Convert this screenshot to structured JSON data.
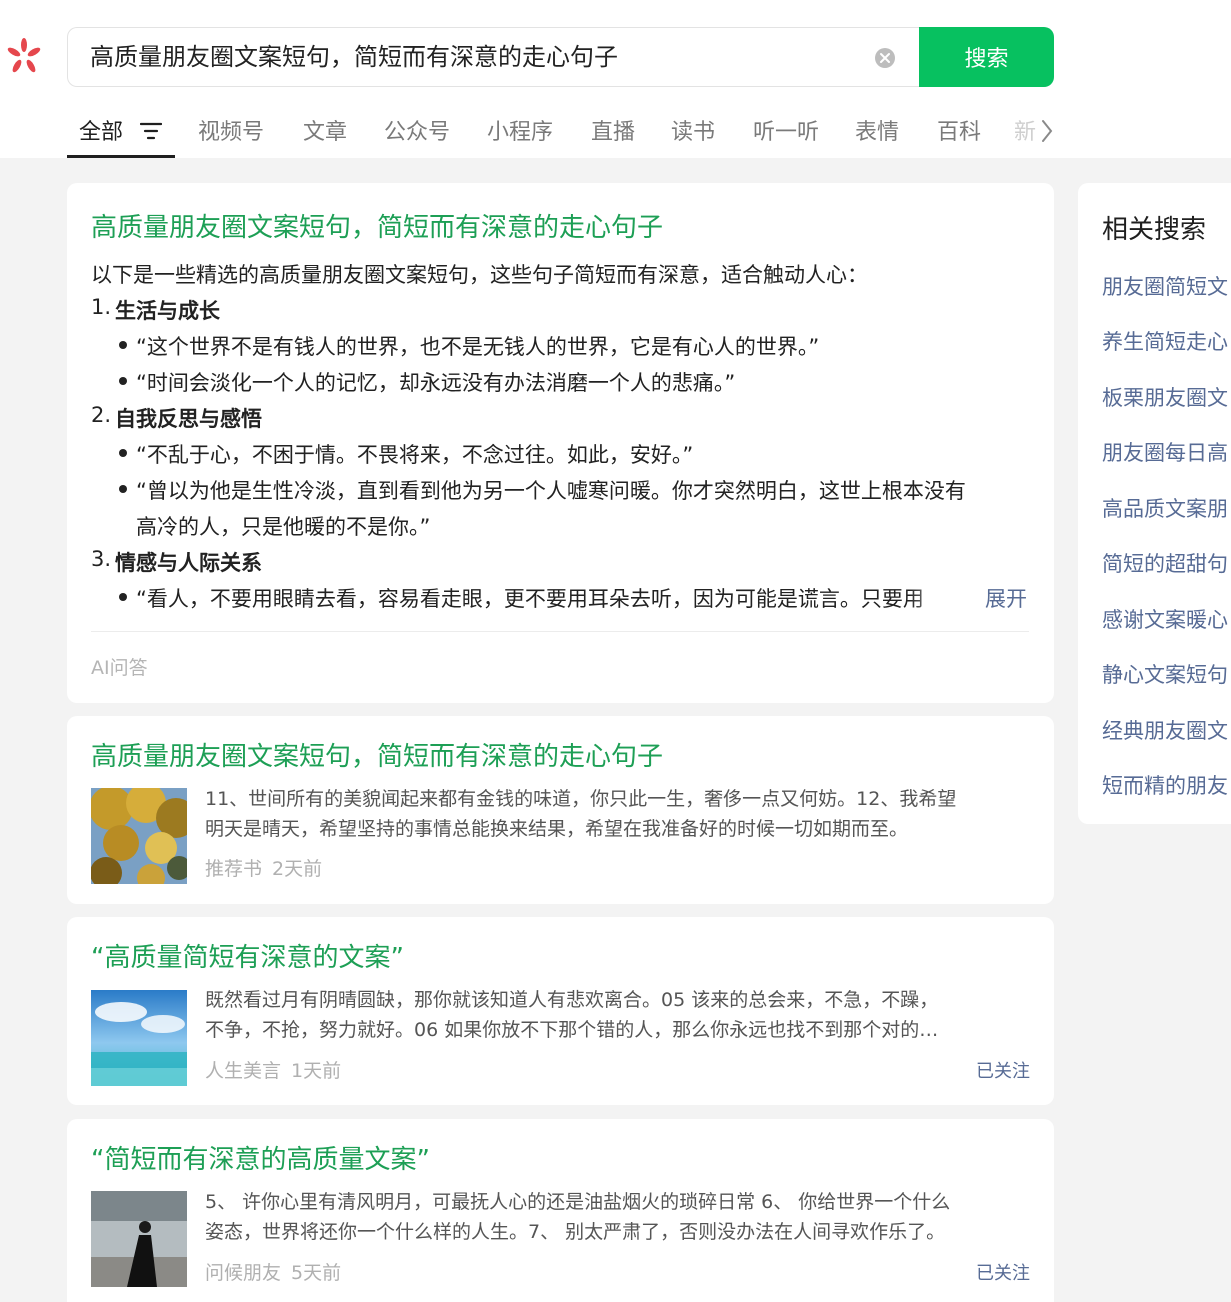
{
  "search": {
    "query": "高质量朋友圈文案短句，简短而有深意的走心句子",
    "button_label": "搜索"
  },
  "tabs": {
    "items": [
      "全部",
      "视频号",
      "文章",
      "公众号",
      "小程序",
      "直播",
      "读书",
      "听一听",
      "表情",
      "百科"
    ],
    "overflow_partial": "新"
  },
  "ai_card": {
    "title": "高质量朋友圈文案短句，简短而有深意的走心句子",
    "intro": "以下是一些精选的高质量朋友圈文案短句，这些句子简短而有深意，适合触动人心：",
    "sections": [
      {
        "num": "1.",
        "head": "生活与成长"
      },
      {
        "num": "2.",
        "head": "自我反思与感悟"
      },
      {
        "num": "3.",
        "head": "情感与人际关系"
      }
    ],
    "bullets": [
      "“这个世界不是有钱人的世界，也不是无钱人的世界，它是有心人的世界。”",
      "“时间会淡化一个人的记忆，却永远没有办法消磨一个人的悲痛。”",
      "“不乱于心，不困于情。不畏将来，不念过往。如此，安好。”",
      "“曾以为他是生性冷淡，直到看到他为另一个人嘘寒问暖。你才突然明白，这世上根本没有",
      "高冷的人，只是他暖的不是你。”",
      "“看人，不要用眼睛去看，容易看走眼，更不要用耳朵去听，因为可能是谎言。只要用"
    ],
    "expand_label": "展开",
    "source_label": "AI问答"
  },
  "results": [
    {
      "title": "高质量朋友圈文案短句，简短而有深意的走心句子",
      "snippet_lines": [
        "11、世间所有的美貌闻起来都有金钱的味道，你只此一生，奢侈一点又何妨。12、我希望",
        "明天是晴天，希望坚持的事情总能换来结果，希望在我准备好的时候一切如期而至。"
      ],
      "source": "推荐书",
      "time": "2天前",
      "follow": ""
    },
    {
      "title": "“高质量简短有深意的文案”",
      "snippet_lines": [
        "既然看过月有阴晴圆缺，那你就该知道人有悲欢离合。05 该来的总会来，不急，不躁，",
        "不争，不抢，努力就好。06 如果你放不下那个错的人，那么你永远也找不到那个对的…"
      ],
      "source": "人生美言",
      "time": "1天前",
      "follow": "已关注"
    },
    {
      "title": "“简短而有深意的高质量文案”",
      "snippet_lines": [
        "5、 许你心里有清风明月，可最抚人心的还是油盐烟火的琐碎日常 6、 你给世界一个什么",
        "姿态，世界将还你一个什么样的人生。7、 别太严肃了，否则没办法在人间寻欢作乐了。"
      ],
      "source": "问候朋友",
      "time": "5天前",
      "follow": "已关注"
    }
  ],
  "related": {
    "title": "相关搜索",
    "items": [
      "朋友圈简短文",
      "养生简短走心",
      "板栗朋友圈文",
      "朋友圈每日高",
      "高品质文案朋",
      "简短的超甜句",
      "感谢文案暖心",
      "静心文案短句",
      "经典朋友圈文",
      "短而精的朋友"
    ]
  },
  "colors": {
    "accent": "#07c160",
    "title_green": "#1d9f55",
    "link": "#576b95"
  }
}
